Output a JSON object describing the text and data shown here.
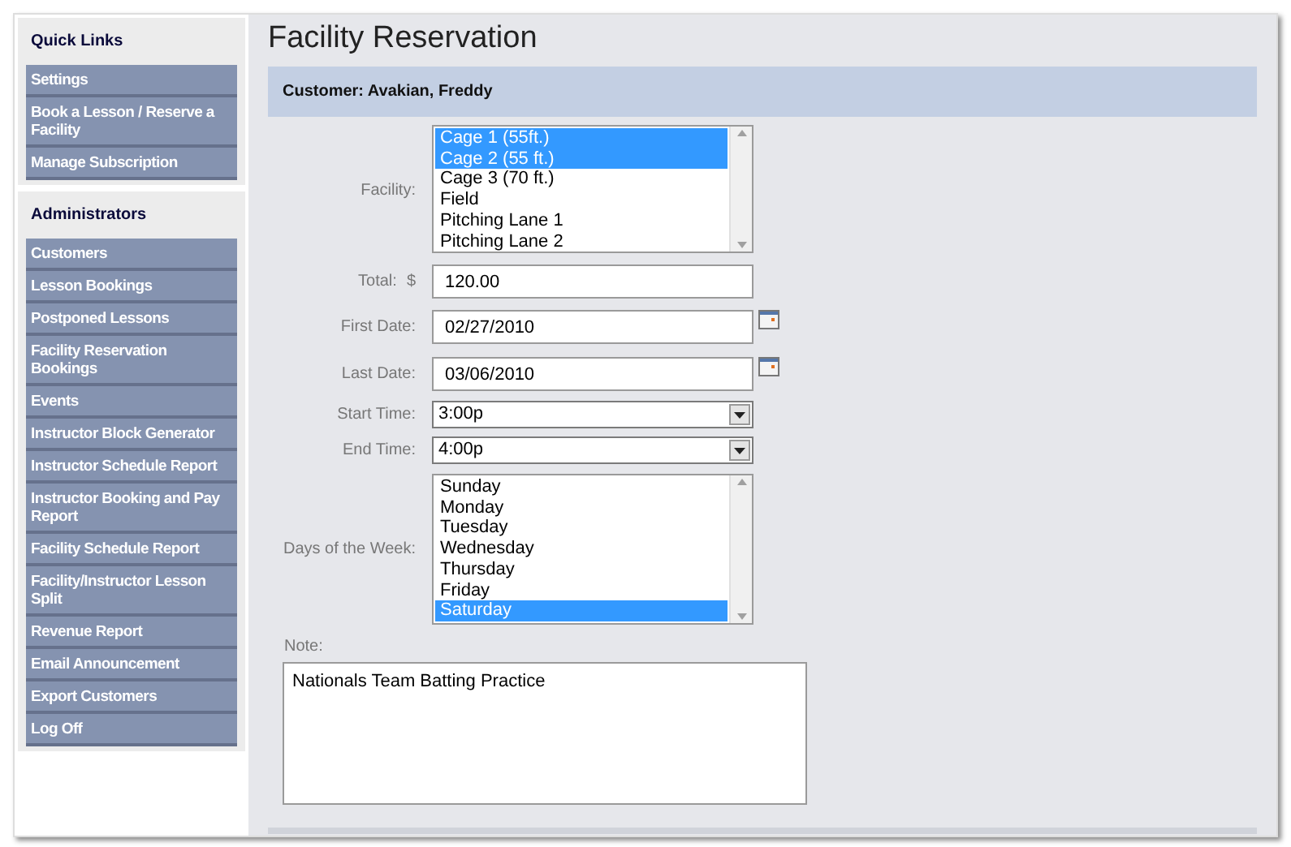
{
  "sidebar": {
    "sections": [
      {
        "title": "Quick Links",
        "items": [
          "Settings",
          "Book a Lesson / Reserve a Facility",
          "Manage Subscription"
        ]
      },
      {
        "title": "Administrators",
        "items": [
          "Customers",
          "Lesson Bookings",
          "Postponed Lessons",
          "Facility Reservation Bookings",
          "Events",
          "Instructor Block Generator",
          "Instructor Schedule Report",
          "Instructor Booking and Pay Report",
          "Facility Schedule Report",
          "Facility/Instructor Lesson Split",
          "Revenue Report",
          "Email Announcement",
          "Export Customers",
          "Log Off"
        ]
      }
    ]
  },
  "page_title": "Facility Reservation",
  "customer_bar": "Customer: Avakian, Freddy",
  "form": {
    "facility": {
      "label": "Facility:",
      "options": [
        {
          "label": "Cage 1 (55ft.)",
          "selected": true
        },
        {
          "label": "Cage 2 (55 ft.)",
          "selected": true
        },
        {
          "label": "Cage 3 (70 ft.)",
          "selected": false
        },
        {
          "label": "Field",
          "selected": false
        },
        {
          "label": "Pitching Lane 1",
          "selected": false
        },
        {
          "label": "Pitching Lane 2",
          "selected": false
        }
      ]
    },
    "total": {
      "label": "Total:",
      "currency": "$",
      "value": "120.00"
    },
    "first_date": {
      "label": "First Date:",
      "value": "02/27/2010"
    },
    "last_date": {
      "label": "Last Date:",
      "value": "03/06/2010"
    },
    "start_time": {
      "label": "Start Time:",
      "value": "3:00p"
    },
    "end_time": {
      "label": "End Time:",
      "value": "4:00p"
    },
    "days": {
      "label": "Days of the Week:",
      "options": [
        {
          "label": "Sunday",
          "selected": false
        },
        {
          "label": "Monday",
          "selected": false
        },
        {
          "label": "Tuesday",
          "selected": false
        },
        {
          "label": "Wednesday",
          "selected": false
        },
        {
          "label": "Thursday",
          "selected": false
        },
        {
          "label": "Friday",
          "selected": false
        },
        {
          "label": "Saturday",
          "selected": true
        }
      ]
    },
    "note": {
      "label": "Note:",
      "value": "Nationals Team Batting Practice"
    }
  }
}
